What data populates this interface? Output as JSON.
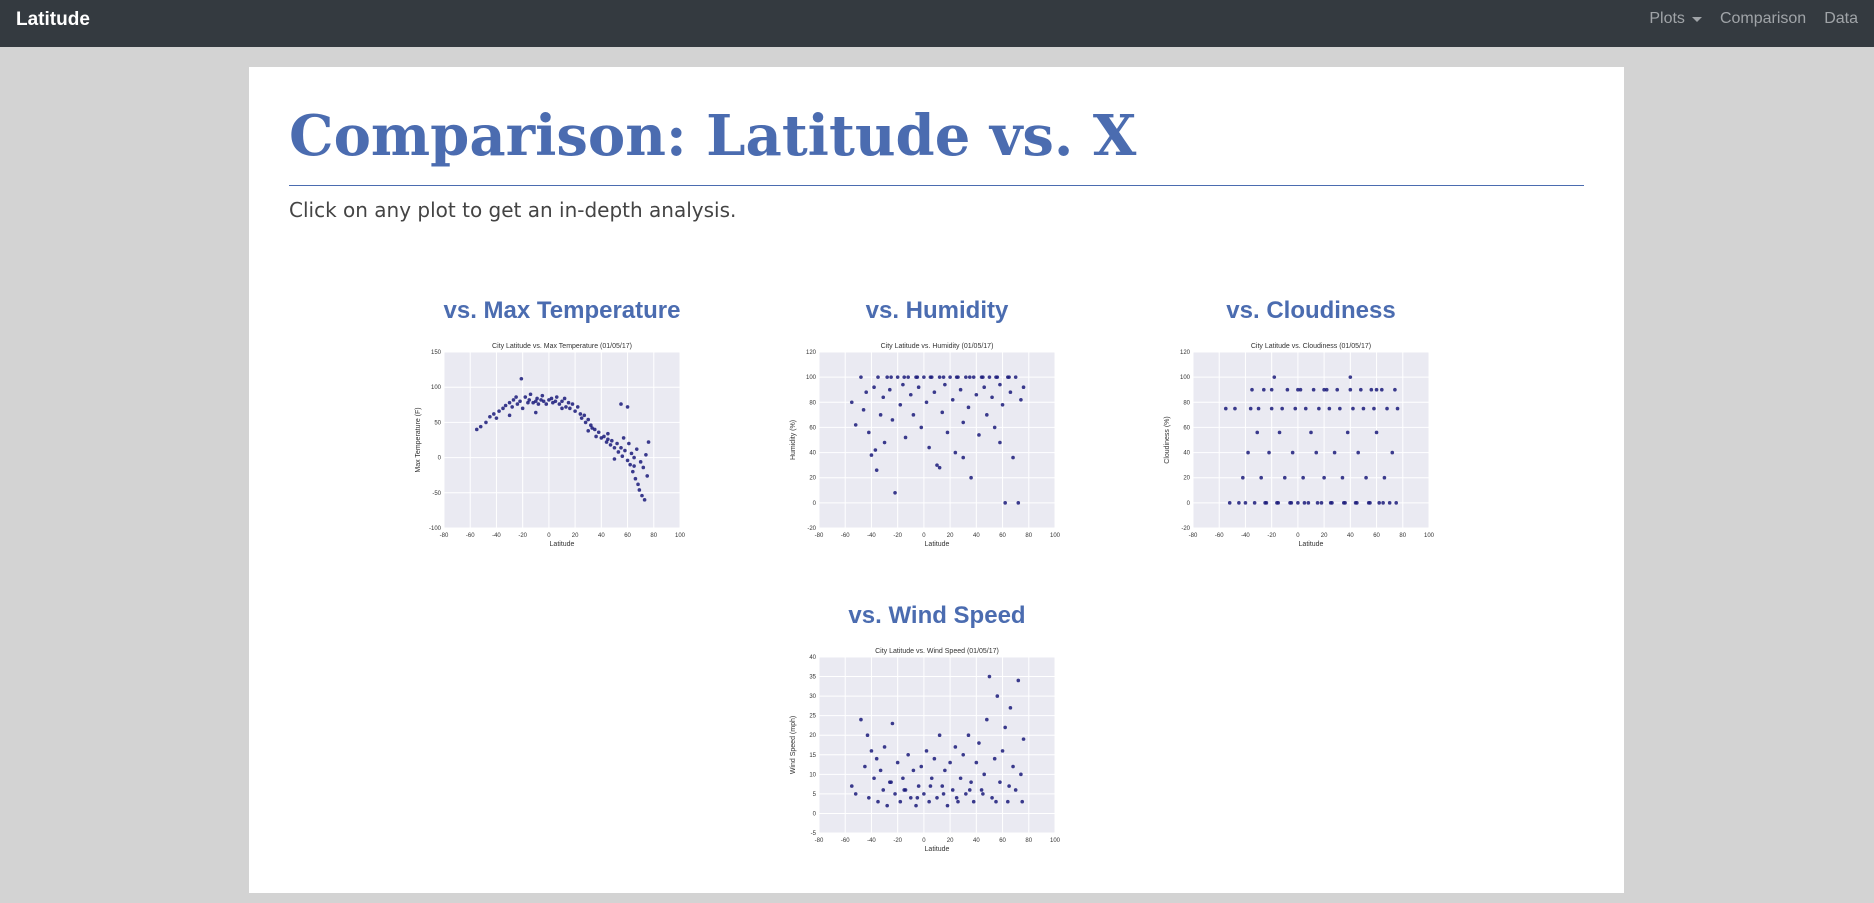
{
  "navbar": {
    "brand": "Latitude",
    "links": [
      {
        "label": "Plots",
        "dropdown": true
      },
      {
        "label": "Comparison"
      },
      {
        "label": "Data"
      }
    ]
  },
  "page": {
    "title": "Comparison: Latitude vs. X",
    "subtitle": "Click on any plot to get an in-depth analysis."
  },
  "colors": {
    "accent": "#4b6cb0",
    "navbar": "#343a40",
    "background": "#d3d3d3",
    "marker": "#1a1a7a",
    "plot_bg": "#eaeaf2"
  },
  "plots": [
    {
      "heading": "vs. Max Temperature"
    },
    {
      "heading": "vs. Humidity"
    },
    {
      "heading": "vs. Cloudiness"
    },
    {
      "heading": "vs. Wind Speed"
    }
  ],
  "chart_data": [
    {
      "type": "scatter",
      "title": "City Latitude vs. Max Temperature (01/05/17)",
      "xlabel": "Latitude",
      "ylabel": "Max Temperature (F)",
      "xlim": [
        -80,
        100
      ],
      "ylim": [
        -100,
        150
      ],
      "xticks": [
        -80,
        -60,
        -40,
        -20,
        0,
        20,
        40,
        60,
        80,
        100
      ],
      "yticks": [
        -100,
        -50,
        0,
        50,
        100,
        150
      ],
      "grid": true,
      "points": [
        [
          -55,
          40
        ],
        [
          -52,
          44
        ],
        [
          -48,
          50
        ],
        [
          -45,
          58
        ],
        [
          -42,
          62
        ],
        [
          -40,
          56
        ],
        [
          -38,
          66
        ],
        [
          -35,
          70
        ],
        [
          -33,
          74
        ],
        [
          -30,
          78
        ],
        [
          -28,
          72
        ],
        [
          -27,
          82
        ],
        [
          -25,
          86
        ],
        [
          -24,
          76
        ],
        [
          -22,
          80
        ],
        [
          -21,
          112
        ],
        [
          -20,
          70
        ],
        [
          -18,
          86
        ],
        [
          -16,
          78
        ],
        [
          -15,
          82
        ],
        [
          -14,
          90
        ],
        [
          -12,
          78
        ],
        [
          -10,
          80
        ],
        [
          -9,
          84
        ],
        [
          -8,
          76
        ],
        [
          -6,
          82
        ],
        [
          -5,
          88
        ],
        [
          -4,
          80
        ],
        [
          -2,
          76
        ],
        [
          0,
          82
        ],
        [
          2,
          84
        ],
        [
          3,
          78
        ],
        [
          5,
          80
        ],
        [
          6,
          86
        ],
        [
          8,
          76
        ],
        [
          10,
          80
        ],
        [
          12,
          84
        ],
        [
          13,
          72
        ],
        [
          15,
          78
        ],
        [
          16,
          70
        ],
        [
          18,
          76
        ],
        [
          20,
          66
        ],
        [
          22,
          72
        ],
        [
          24,
          62
        ],
        [
          25,
          56
        ],
        [
          27,
          60
        ],
        [
          28,
          50
        ],
        [
          30,
          54
        ],
        [
          32,
          46
        ],
        [
          33,
          42
        ],
        [
          35,
          40
        ],
        [
          36,
          30
        ],
        [
          38,
          36
        ],
        [
          40,
          28
        ],
        [
          42,
          30
        ],
        [
          44,
          22
        ],
        [
          45,
          26
        ],
        [
          47,
          18
        ],
        [
          48,
          24
        ],
        [
          50,
          14
        ],
        [
          52,
          20
        ],
        [
          53,
          8
        ],
        [
          55,
          14
        ],
        [
          56,
          2
        ],
        [
          57,
          28
        ],
        [
          58,
          10
        ],
        [
          60,
          -4
        ],
        [
          61,
          20
        ],
        [
          62,
          -10
        ],
        [
          63,
          6
        ],
        [
          64,
          -20
        ],
        [
          65,
          0
        ],
        [
          66,
          -30
        ],
        [
          67,
          12
        ],
        [
          68,
          -38
        ],
        [
          69,
          -46
        ],
        [
          70,
          -6
        ],
        [
          71,
          -54
        ],
        [
          72,
          -14
        ],
        [
          73,
          -60
        ],
        [
          74,
          4
        ],
        [
          75,
          -26
        ],
        [
          76,
          22
        ],
        [
          -30,
          60
        ],
        [
          -10,
          64
        ],
        [
          10,
          70
        ],
        [
          30,
          38
        ],
        [
          55,
          76
        ],
        [
          60,
          72
        ],
        [
          45,
          34
        ],
        [
          50,
          -2
        ],
        [
          65,
          -12
        ]
      ]
    },
    {
      "type": "scatter",
      "title": "City Latitude vs. Humidity (01/05/17)",
      "xlabel": "Latitude",
      "ylabel": "Humidity (%)",
      "xlim": [
        -80,
        100
      ],
      "ylim": [
        -20,
        120
      ],
      "xticks": [
        -80,
        -60,
        -40,
        -20,
        0,
        20,
        40,
        60,
        80,
        100
      ],
      "yticks": [
        -20,
        0,
        20,
        40,
        60,
        80,
        100,
        120
      ],
      "grid": true,
      "points": [
        [
          -55,
          80
        ],
        [
          -52,
          62
        ],
        [
          -48,
          100
        ],
        [
          -46,
          74
        ],
        [
          -44,
          88
        ],
        [
          -42,
          56
        ],
        [
          -40,
          38
        ],
        [
          -38,
          92
        ],
        [
          -36,
          26
        ],
        [
          -35,
          100
        ],
        [
          -33,
          70
        ],
        [
          -31,
          84
        ],
        [
          -30,
          48
        ],
        [
          -28,
          100
        ],
        [
          -26,
          90
        ],
        [
          -24,
          66
        ],
        [
          -22,
          8
        ],
        [
          -20,
          100
        ],
        [
          -18,
          78
        ],
        [
          -16,
          94
        ],
        [
          -14,
          52
        ],
        [
          -12,
          100
        ],
        [
          -10,
          86
        ],
        [
          -8,
          70
        ],
        [
          -6,
          100
        ],
        [
          -4,
          92
        ],
        [
          -2,
          60
        ],
        [
          0,
          100
        ],
        [
          2,
          80
        ],
        [
          4,
          44
        ],
        [
          6,
          100
        ],
        [
          8,
          88
        ],
        [
          10,
          30
        ],
        [
          12,
          100
        ],
        [
          14,
          72
        ],
        [
          16,
          94
        ],
        [
          18,
          56
        ],
        [
          20,
          100
        ],
        [
          22,
          82
        ],
        [
          24,
          40
        ],
        [
          26,
          100
        ],
        [
          28,
          90
        ],
        [
          30,
          64
        ],
        [
          32,
          100
        ],
        [
          34,
          76
        ],
        [
          36,
          20
        ],
        [
          38,
          100
        ],
        [
          40,
          86
        ],
        [
          42,
          54
        ],
        [
          44,
          100
        ],
        [
          46,
          92
        ],
        [
          48,
          70
        ],
        [
          50,
          100
        ],
        [
          52,
          84
        ],
        [
          54,
          60
        ],
        [
          56,
          100
        ],
        [
          58,
          94
        ],
        [
          60,
          78
        ],
        [
          62,
          0
        ],
        [
          64,
          100
        ],
        [
          66,
          88
        ],
        [
          68,
          36
        ],
        [
          70,
          100
        ],
        [
          72,
          0
        ],
        [
          74,
          82
        ],
        [
          76,
          92
        ],
        [
          -25,
          100
        ],
        [
          -15,
          100
        ],
        [
          -5,
          100
        ],
        [
          5,
          100
        ],
        [
          15,
          100
        ],
        [
          25,
          100
        ],
        [
          35,
          100
        ],
        [
          45,
          100
        ],
        [
          55,
          100
        ],
        [
          65,
          100
        ],
        [
          -37,
          42
        ],
        [
          12,
          28
        ],
        [
          30,
          36
        ],
        [
          58,
          48
        ]
      ]
    },
    {
      "type": "scatter",
      "title": "City Latitude vs. Cloudiness (01/05/17)",
      "xlabel": "Latitude",
      "ylabel": "Cloudiness (%)",
      "xlim": [
        -80,
        100
      ],
      "ylim": [
        -20,
        120
      ],
      "xticks": [
        -80,
        -60,
        -40,
        -20,
        0,
        20,
        40,
        60,
        80,
        100
      ],
      "yticks": [
        -20,
        0,
        20,
        40,
        60,
        80,
        100,
        120
      ],
      "grid": true,
      "points": [
        [
          -55,
          75
        ],
        [
          -52,
          0
        ],
        [
          -48,
          75
        ],
        [
          -45,
          0
        ],
        [
          -42,
          20
        ],
        [
          -40,
          0
        ],
        [
          -38,
          40
        ],
        [
          -36,
          75
        ],
        [
          -35,
          90
        ],
        [
          -33,
          0
        ],
        [
          -31,
          56
        ],
        [
          -30,
          75
        ],
        [
          -28,
          20
        ],
        [
          -26,
          90
        ],
        [
          -24,
          0
        ],
        [
          -22,
          40
        ],
        [
          -20,
          75
        ],
        [
          -18,
          100
        ],
        [
          -16,
          0
        ],
        [
          -14,
          56
        ],
        [
          -12,
          75
        ],
        [
          -10,
          20
        ],
        [
          -8,
          90
        ],
        [
          -6,
          0
        ],
        [
          -4,
          40
        ],
        [
          -2,
          75
        ],
        [
          0,
          0
        ],
        [
          2,
          90
        ],
        [
          4,
          20
        ],
        [
          6,
          75
        ],
        [
          8,
          0
        ],
        [
          10,
          56
        ],
        [
          12,
          90
        ],
        [
          14,
          40
        ],
        [
          16,
          75
        ],
        [
          18,
          0
        ],
        [
          20,
          20
        ],
        [
          22,
          90
        ],
        [
          24,
          75
        ],
        [
          26,
          0
        ],
        [
          28,
          40
        ],
        [
          30,
          90
        ],
        [
          32,
          75
        ],
        [
          34,
          20
        ],
        [
          36,
          0
        ],
        [
          38,
          56
        ],
        [
          40,
          90
        ],
        [
          42,
          75
        ],
        [
          44,
          0
        ],
        [
          46,
          40
        ],
        [
          48,
          90
        ],
        [
          50,
          75
        ],
        [
          52,
          20
        ],
        [
          54,
          0
        ],
        [
          56,
          90
        ],
        [
          58,
          75
        ],
        [
          60,
          56
        ],
        [
          62,
          0
        ],
        [
          64,
          90
        ],
        [
          66,
          20
        ],
        [
          68,
          75
        ],
        [
          70,
          0
        ],
        [
          72,
          40
        ],
        [
          74,
          90
        ],
        [
          76,
          75
        ],
        [
          -25,
          0
        ],
        [
          -15,
          0
        ],
        [
          -5,
          0
        ],
        [
          5,
          0
        ],
        [
          15,
          0
        ],
        [
          25,
          0
        ],
        [
          35,
          0
        ],
        [
          45,
          0
        ],
        [
          55,
          0
        ],
        [
          65,
          0
        ],
        [
          75,
          0
        ],
        [
          -20,
          90
        ],
        [
          0,
          90
        ],
        [
          20,
          90
        ],
        [
          40,
          100
        ],
        [
          60,
          90
        ]
      ]
    },
    {
      "type": "scatter",
      "title": "City Latitude vs. Wind Speed (01/05/17)",
      "xlabel": "Latitude",
      "ylabel": "Wind Speed (mph)",
      "xlim": [
        -80,
        100
      ],
      "ylim": [
        -5,
        40
      ],
      "xticks": [
        -80,
        -60,
        -40,
        -20,
        0,
        20,
        40,
        60,
        80,
        100
      ],
      "yticks": [
        -5,
        0,
        5,
        10,
        15,
        20,
        25,
        30,
        35,
        40
      ],
      "grid": true,
      "points": [
        [
          -55,
          7
        ],
        [
          -52,
          5
        ],
        [
          -48,
          24
        ],
        [
          -45,
          12
        ],
        [
          -43,
          20
        ],
        [
          -42,
          4
        ],
        [
          -40,
          16
        ],
        [
          -38,
          9
        ],
        [
          -36,
          14
        ],
        [
          -35,
          3
        ],
        [
          -33,
          11
        ],
        [
          -31,
          6
        ],
        [
          -30,
          17
        ],
        [
          -28,
          2
        ],
        [
          -26,
          8
        ],
        [
          -24,
          23
        ],
        [
          -22,
          5
        ],
        [
          -20,
          13
        ],
        [
          -18,
          3
        ],
        [
          -16,
          9
        ],
        [
          -14,
          6
        ],
        [
          -12,
          15
        ],
        [
          -10,
          4
        ],
        [
          -8,
          11
        ],
        [
          -6,
          2
        ],
        [
          -4,
          7
        ],
        [
          -2,
          12
        ],
        [
          0,
          5
        ],
        [
          2,
          16
        ],
        [
          4,
          3
        ],
        [
          6,
          9
        ],
        [
          8,
          14
        ],
        [
          10,
          4
        ],
        [
          12,
          20
        ],
        [
          14,
          7
        ],
        [
          16,
          11
        ],
        [
          18,
          2
        ],
        [
          20,
          13
        ],
        [
          22,
          6
        ],
        [
          24,
          17
        ],
        [
          26,
          3
        ],
        [
          28,
          9
        ],
        [
          30,
          15
        ],
        [
          32,
          5
        ],
        [
          34,
          20
        ],
        [
          36,
          8
        ],
        [
          38,
          3
        ],
        [
          40,
          13
        ],
        [
          42,
          18
        ],
        [
          44,
          6
        ],
        [
          46,
          10
        ],
        [
          48,
          24
        ],
        [
          50,
          35
        ],
        [
          52,
          4
        ],
        [
          54,
          14
        ],
        [
          56,
          30
        ],
        [
          58,
          8
        ],
        [
          60,
          16
        ],
        [
          62,
          22
        ],
        [
          64,
          3
        ],
        [
          66,
          27
        ],
        [
          68,
          12
        ],
        [
          70,
          6
        ],
        [
          72,
          34
        ],
        [
          74,
          10
        ],
        [
          76,
          19
        ],
        [
          -25,
          8
        ],
        [
          -15,
          6
        ],
        [
          -5,
          4
        ],
        [
          5,
          7
        ],
        [
          15,
          5
        ],
        [
          25,
          4
        ],
        [
          35,
          6
        ],
        [
          45,
          5
        ],
        [
          55,
          3
        ],
        [
          65,
          7
        ],
        [
          75,
          3
        ]
      ]
    }
  ]
}
